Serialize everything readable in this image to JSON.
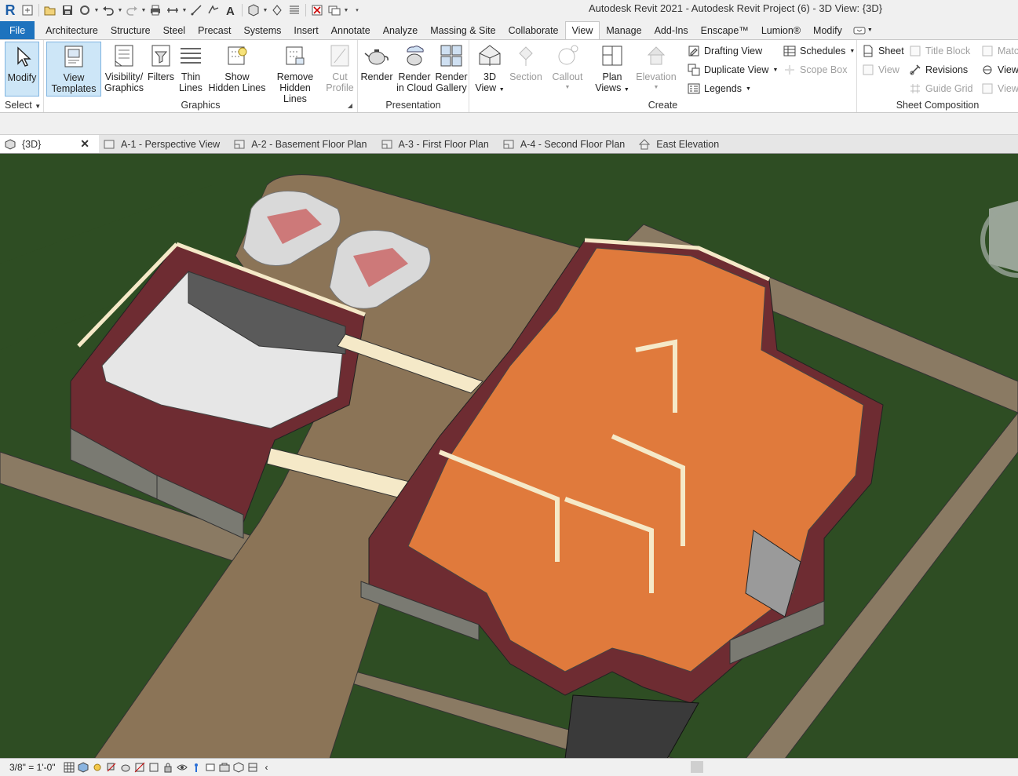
{
  "window": {
    "title": "Autodesk Revit 2021 - Autodesk Revit Project  (6) - 3D View: {3D}",
    "app_letter": "R"
  },
  "menu_tabs": [
    {
      "label": "File"
    },
    {
      "label": "Architecture"
    },
    {
      "label": "Structure"
    },
    {
      "label": "Steel"
    },
    {
      "label": "Precast"
    },
    {
      "label": "Systems"
    },
    {
      "label": "Insert"
    },
    {
      "label": "Annotate"
    },
    {
      "label": "Analyze"
    },
    {
      "label": "Massing & Site"
    },
    {
      "label": "Collaborate"
    },
    {
      "label": "View"
    },
    {
      "label": "Manage"
    },
    {
      "label": "Add-Ins"
    },
    {
      "label": "Enscape™"
    },
    {
      "label": "Lumion®"
    },
    {
      "label": "Modify"
    }
  ],
  "ribbon": {
    "select": {
      "modify": "Modify",
      "title": "Select"
    },
    "graphics": {
      "view_templates_1": "View",
      "view_templates_2": "Templates",
      "visibility_1": "Visibility/",
      "visibility_2": "Graphics",
      "filters": "Filters",
      "thin_1": "Thin",
      "thin_2": "Lines",
      "show_1": "Show",
      "show_2": "Hidden Lines",
      "remove_1": "Remove",
      "remove_2": "Hidden Lines",
      "cut_1": "Cut",
      "cut_2": "Profile",
      "title": "Graphics"
    },
    "presentation": {
      "render": "Render",
      "render_cloud_1": "Render",
      "render_cloud_2": "in Cloud",
      "render_gallery_1": "Render",
      "render_gallery_2": "Gallery",
      "title": "Presentation"
    },
    "create": {
      "view3d_1": "3D",
      "view3d_2": "View",
      "section": "Section",
      "callout": "Callout",
      "plan_1": "Plan",
      "plan_2": "Views",
      "elevation": "Elevation",
      "drafting": "Drafting  View",
      "duplicate": "Duplicate  View",
      "legends": "Legends",
      "schedules": "Schedules",
      "scope_box": "Scope  Box",
      "title": "Create"
    },
    "sheet": {
      "sheet": "Sheet",
      "title_block": "Title  Block",
      "match": "Matc",
      "view": "View",
      "revisions": "Revisions",
      "view2": "View",
      "guide_grid": "Guide  Grid",
      "viewport": "Viewp",
      "title": "Sheet Composition"
    }
  },
  "view_tabs": [
    {
      "label": "{3D}"
    },
    {
      "label": "A-1 - Perspective View"
    },
    {
      "label": "A-2 - Basement Floor Plan"
    },
    {
      "label": "A-3 - First Floor Plan"
    },
    {
      "label": "A-4 - Second Floor Plan"
    },
    {
      "label": "East Elevation"
    }
  ],
  "status": {
    "scale": "3/8\" = 1'-0\""
  },
  "colors": {
    "accent": "#1e73be",
    "grass": "#2e4d23",
    "drive": "#8b7457",
    "floor": "#e07a3c",
    "wall_brick": "#6e2c32",
    "wall_cut": "#f5e9c8",
    "stone": "#7a7a72"
  }
}
